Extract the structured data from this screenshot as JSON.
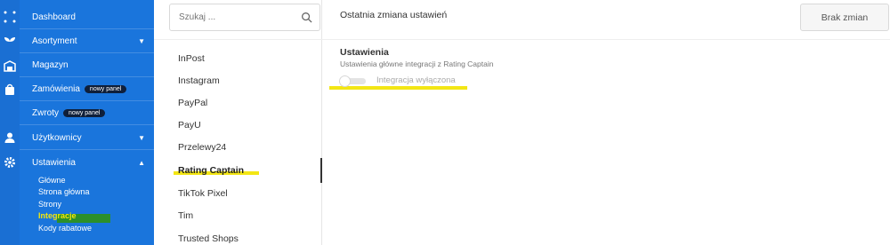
{
  "colors": {
    "sidebar": "#1a75dc",
    "rail": "#1a6fd3",
    "badge": "#0f1f3a",
    "highlight_yellow": "#f3e614",
    "highlight_green": "#2c8f2a"
  },
  "rail_icons": [
    "grid-icon",
    "plant-icon",
    "warehouse-icon",
    "bag-icon",
    "user-icon",
    "gear-icon"
  ],
  "sidebar": {
    "dashboard": "Dashboard",
    "asortyment": "Asortyment",
    "magazyn": "Magazyn",
    "zamowienia": "Zamówienia",
    "zamowienia_badge": "nowy panel",
    "zwroty": "Zwroty",
    "zwroty_badge": "nowy panel",
    "uzytkownicy": "Użytkownicy",
    "ustawienia": "Ustawienia",
    "sub_items": [
      "Główne",
      "Strona główna",
      "Strony",
      "Integracje",
      "Kody rabatowe"
    ]
  },
  "search": {
    "placeholder": "Szukaj ..."
  },
  "integrations": [
    "InPost",
    "Instagram",
    "PayPal",
    "PayU",
    "Przelewy24",
    "Rating Captain",
    "TikTok Pixel",
    "Tim",
    "Trusted Shops"
  ],
  "header": {
    "title": "Ostatnia zmiana ustawień",
    "button": "Brak zmian"
  },
  "settings": {
    "title": "Ustawienia",
    "subtitle": "Ustawienia główne integracji z Rating Captain",
    "toggle_label": "Integracja wyłączona",
    "toggle_on": false
  }
}
